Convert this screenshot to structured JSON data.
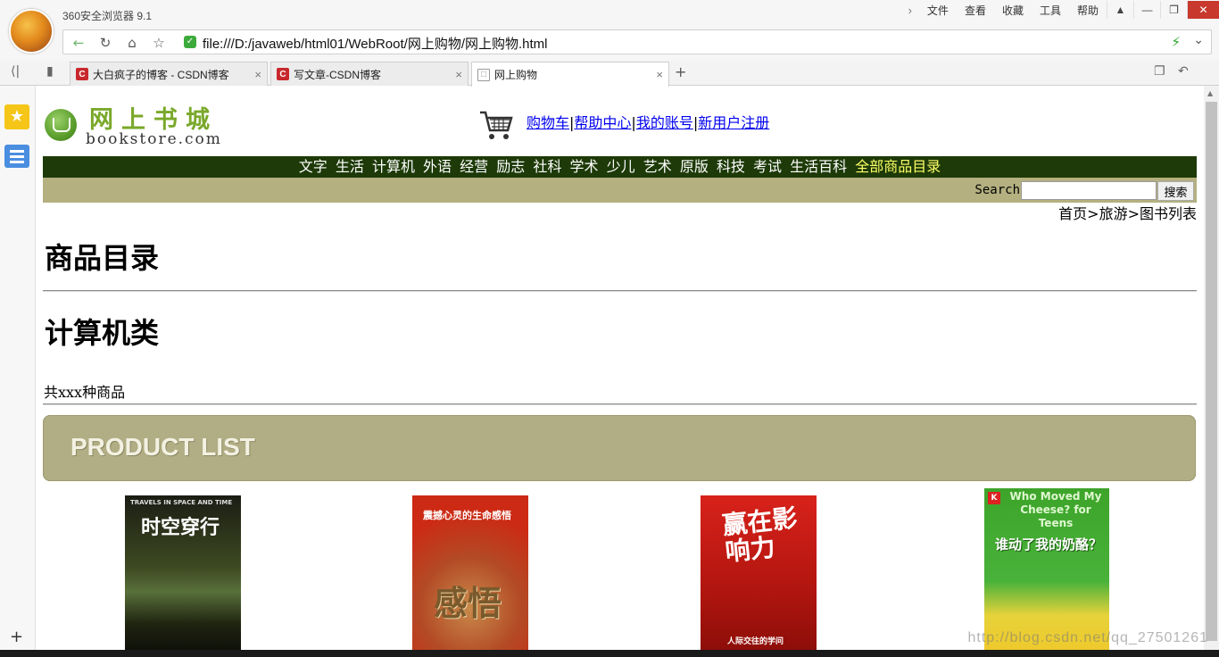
{
  "browser": {
    "app_title": "360安全浏览器 9.1",
    "menu": [
      "文件",
      "查看",
      "收藏",
      "工具",
      "帮助"
    ],
    "url": "file:///D:/javaweb/html01/WebRoot/网上购物/网上购物.html",
    "tabs": [
      {
        "label": "大白疯子的博客 - CSDN博客",
        "favicon": "C"
      },
      {
        "label": "写文章-CSDN博客",
        "favicon": "C"
      },
      {
        "label": "网上购物",
        "favicon": "doc"
      }
    ],
    "watermark": "http://blog.csdn.net/qq_27501261"
  },
  "site": {
    "logo_cn": "网上书城",
    "logo_en": "bookstore.com",
    "header_links": [
      "购物车",
      "帮助中心",
      "我的账号",
      "新用户注册"
    ],
    "categories": [
      "文字",
      "生活",
      "计算机",
      "外语",
      "经营",
      "励志",
      "社科",
      "学术",
      "少儿",
      "艺术",
      "原版",
      "科技",
      "考试",
      "生活百科"
    ],
    "all_categories_label": "全部商品目录",
    "search": {
      "label": "Search",
      "value": "",
      "button": "搜索"
    },
    "breadcrumb": "首页>旅游>图书列表",
    "heading": "商品目录",
    "subheading": "计算机类",
    "count_text": "共xxx种商品",
    "product_list_banner": "PRODUCT LIST",
    "books": [
      {
        "cover_title": "时空穿行",
        "cover_subtitle": "TRAVELS IN SPACE AND TIME"
      },
      {
        "cover_title": "感悟",
        "cover_subtitle": "震撼心灵的生命感悟"
      },
      {
        "cover_title": "赢在影响力",
        "cover_subtitle": "人际交往的学问"
      },
      {
        "cover_title": "谁动了我的奶酪？",
        "cover_subtitle": "Who Moved My Cheese? for Teens"
      }
    ]
  },
  "colors": {
    "nav_bg": "#1d3a08",
    "search_bg": "#b4b080",
    "banner_bg": "#b1ad84",
    "highlight": "#ffff66",
    "logo_green": "#7aa82a"
  }
}
